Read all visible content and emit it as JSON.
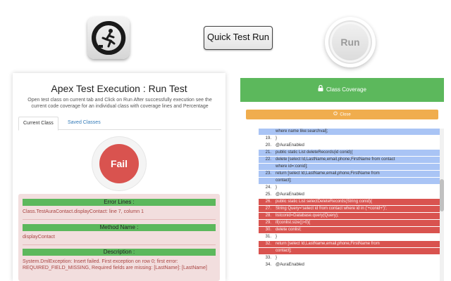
{
  "promo": {
    "quick_test_label": "Quick Test Run",
    "run_label": "Run",
    "app_icon": "running-stopwatch-icon"
  },
  "left_panel": {
    "title": "Apex Test Execution : Run Test",
    "description": "Open test class on current tab and Click on Run After successfully execution see the current code coverage for an individual class with coverage lines and Percentage",
    "tabs": [
      "Current Class",
      "Saved Classes"
    ],
    "result_label": "Fail",
    "sections": {
      "error_lines_header": "Error Lines :",
      "error_lines_text": "Class.TestAuraContact.displayContact: line 7, column 1",
      "method_name_header": "Method Name :",
      "method_name_text": "displayContact",
      "description_header": "Description :",
      "description_text": "System.DmlException: Insert failed. First exception on row 0; first error: REQUIRED_FIELD_MISSING, Required fields are missing: [LastName]: [LastName]"
    },
    "colors": {
      "fail": "#d9534f",
      "section_bar": "#5cb85c",
      "error_bg": "#f2dede"
    }
  },
  "right_panel": {
    "header": "Class Coverage",
    "header_icon": "lock-icon",
    "close_label": "Close",
    "close_icon": "power-icon",
    "code_lines": [
      {
        "num": "",
        "text": "where name like:searchval];",
        "status": "covered"
      },
      {
        "num": "19.",
        "text": "}",
        "status": "none"
      },
      {
        "num": "20.",
        "text": "@AuraEnabled",
        "status": "none"
      },
      {
        "num": "21.",
        "text": "public static List deleteRecords(id conid){",
        "status": "covered"
      },
      {
        "num": "22.",
        "text": "delete [select Id,LastName,email,phone,FirstName from contact",
        "status": "covered"
      },
      {
        "num": "",
        "text": "where id=:conid];",
        "status": "covered"
      },
      {
        "num": "23.",
        "text": "return [select Id,LastName,email,phone,FirstName from",
        "status": "covered"
      },
      {
        "num": "",
        "text": "contact];",
        "status": "covered"
      },
      {
        "num": "24.",
        "text": "}",
        "status": "none"
      },
      {
        "num": "25.",
        "text": "@AuraEnabled",
        "status": "none"
      },
      {
        "num": "26.",
        "text": "public static List selectDeleteRecords(String conid){",
        "status": "uncovered"
      },
      {
        "num": "27.",
        "text": "String Query='select id from contact where id in ('+conid+')';",
        "status": "uncovered"
      },
      {
        "num": "28.",
        "text": "listconid=Database.query(Query);",
        "status": "uncovered"
      },
      {
        "num": "29.",
        "text": "if(conlist.size()>0){",
        "status": "uncovered"
      },
      {
        "num": "30.",
        "text": "delete conlist;",
        "status": "uncovered"
      },
      {
        "num": "31.",
        "text": "}",
        "status": "none"
      },
      {
        "num": "32.",
        "text": "return [select Id,LastName,email,phone,FirstName from",
        "status": "uncovered"
      },
      {
        "num": "",
        "text": "contact];",
        "status": "uncovered"
      },
      {
        "num": "33.",
        "text": "}",
        "status": "none"
      },
      {
        "num": "34.",
        "text": "@AuraEnabled",
        "status": "none"
      }
    ],
    "colors": {
      "header": "#5cb85c",
      "close": "#f0ad4e",
      "covered": "#a9c4f5",
      "uncovered": "#d9534f"
    }
  }
}
